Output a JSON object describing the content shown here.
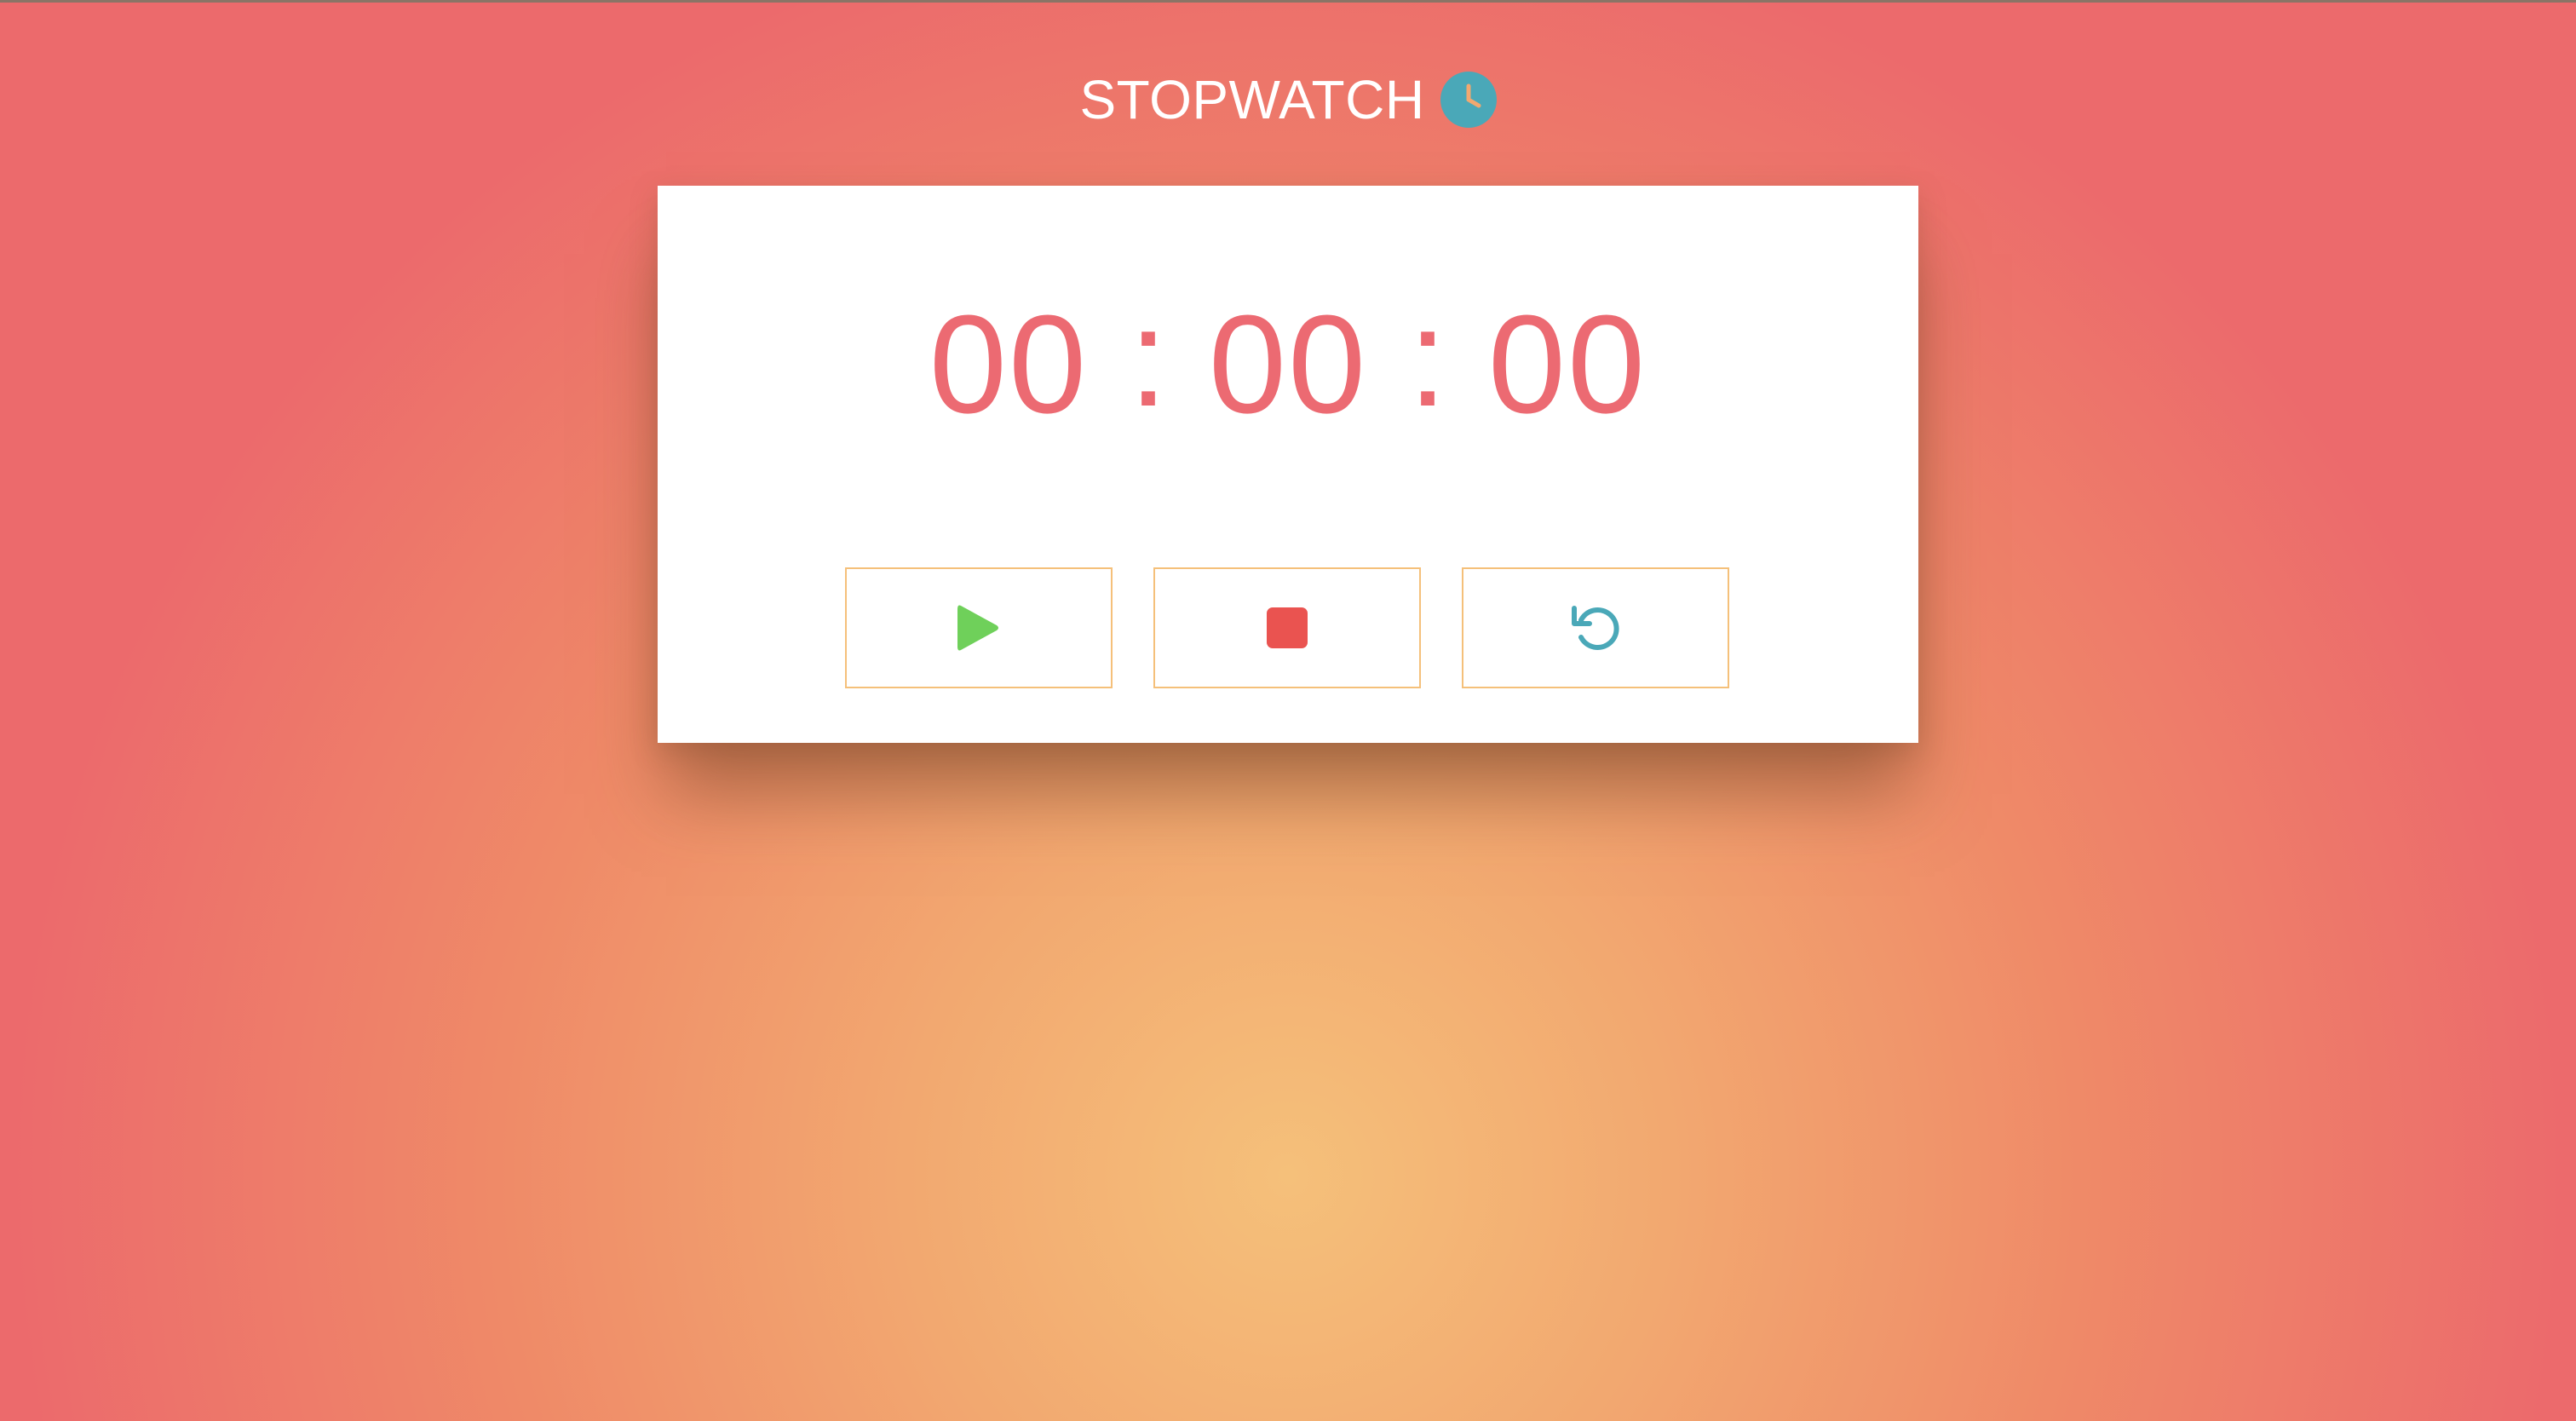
{
  "header": {
    "title": "STOPWATCH",
    "icon": "clock-icon",
    "icon_color": "#4aa8b8"
  },
  "timer": {
    "hours": "00",
    "separator_1": ":",
    "minutes": "00",
    "separator_2": ":",
    "seconds": "00",
    "color": "#ec6a72"
  },
  "controls": [
    {
      "action": "start",
      "icon": "play-icon",
      "color": "#6fd05a"
    },
    {
      "action": "stop",
      "icon": "stop-icon",
      "color": "#ea5350"
    },
    {
      "action": "reset",
      "icon": "reset-icon",
      "color": "#4aa8b8"
    }
  ],
  "colors": {
    "background_center": "#f5c07a",
    "background_edge": "#ec6a6c",
    "button_border": "#f5c07a",
    "card": "#ffffff"
  }
}
